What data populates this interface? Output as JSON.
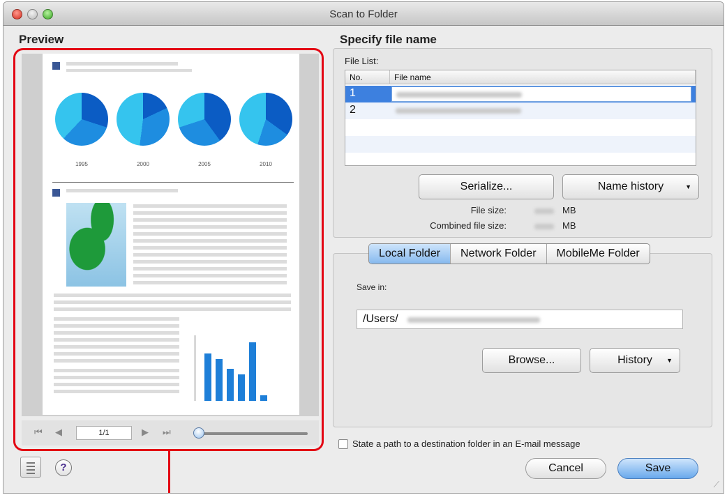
{
  "window": {
    "title": "Scan to Folder"
  },
  "preview": {
    "title": "Preview",
    "chart_years": [
      "1995",
      "2000",
      "2005",
      "2010"
    ],
    "page_indicator": "1/1"
  },
  "file_name": {
    "title": "Specify file name",
    "file_list_label": "File List:",
    "columns": [
      "No.",
      "File name"
    ],
    "rows": [
      {
        "no": "1"
      },
      {
        "no": "2"
      }
    ],
    "serialize_label": "Serialize...",
    "name_history_label": "Name history",
    "file_size_label": "File size:",
    "file_size_unit": "MB",
    "combined_size_label": "Combined file size:",
    "combined_size_unit": "MB"
  },
  "destination": {
    "tabs": [
      "Local Folder",
      "Network Folder",
      "MobileMe Folder"
    ],
    "save_in_label": "Save in:",
    "path_value": "/Users/",
    "browse_label": "Browse...",
    "history_label": "History"
  },
  "footer": {
    "email_checkbox_label": "State a path to a destination folder in an E-mail message",
    "cancel_label": "Cancel",
    "save_label": "Save",
    "help_label": "?"
  }
}
